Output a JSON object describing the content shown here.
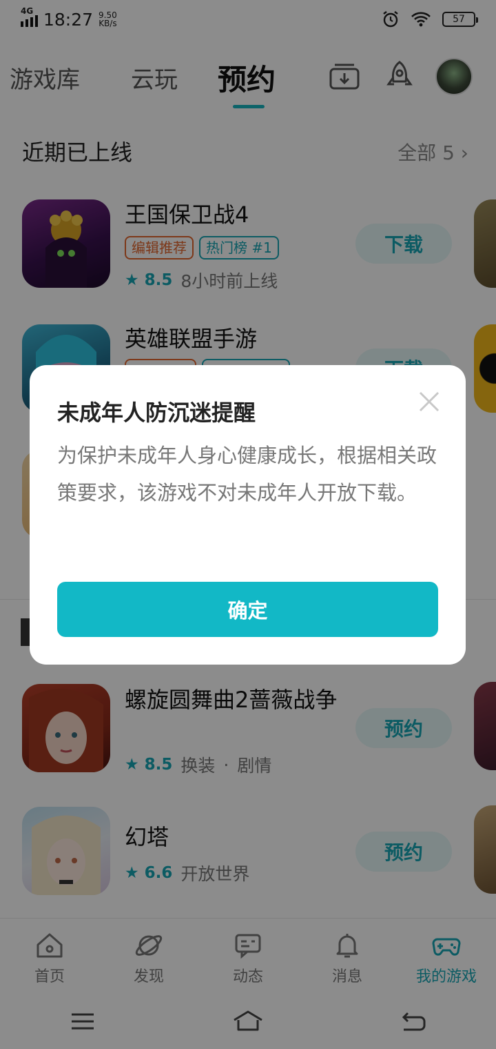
{
  "status": {
    "network": "4G",
    "time": "18:27",
    "speed_value": "9.50",
    "speed_unit": "KB/s",
    "battery": "57"
  },
  "topnav": {
    "tabs": [
      {
        "label": "游戏库"
      },
      {
        "label": "云玩"
      },
      {
        "label": "预约"
      }
    ],
    "active_tab": "预约"
  },
  "recent": {
    "title": "近期已上线",
    "more": "全部 5",
    "games": [
      {
        "name": "王国保卫战4",
        "tag1": "编辑推荐",
        "tag2": "热门榜 #1",
        "rating": "8.5",
        "info": "8小时前上线",
        "action": "下载"
      },
      {
        "name": "英雄联盟手游",
        "action": "下载"
      }
    ]
  },
  "upcoming": {
    "games": [
      {
        "name": "螺旋圆舞曲2蔷薇战争",
        "rating": "8.5",
        "genre1": "换装",
        "sep": "·",
        "genre2": "剧情",
        "action": "预约"
      },
      {
        "name": "幻塔",
        "rating": "6.6",
        "genre1": "开放世界",
        "action": "预约"
      }
    ]
  },
  "bottomnav": {
    "items": [
      {
        "label": "首页"
      },
      {
        "label": "发现"
      },
      {
        "label": "动态"
      },
      {
        "label": "消息"
      },
      {
        "label": "我的游戏"
      }
    ],
    "active": "我的游戏"
  },
  "dialog": {
    "title": "未成年人防沉迷提醒",
    "body": "为保护未成年人身心健康成长，根据相关政策要求，该游戏不对未成年人开放下载。",
    "confirm": "确定"
  },
  "colors": {
    "accent": "#17b5c0",
    "tag_orange": "#e4672e",
    "overlay": "rgba(0,0,0,0.45)"
  }
}
